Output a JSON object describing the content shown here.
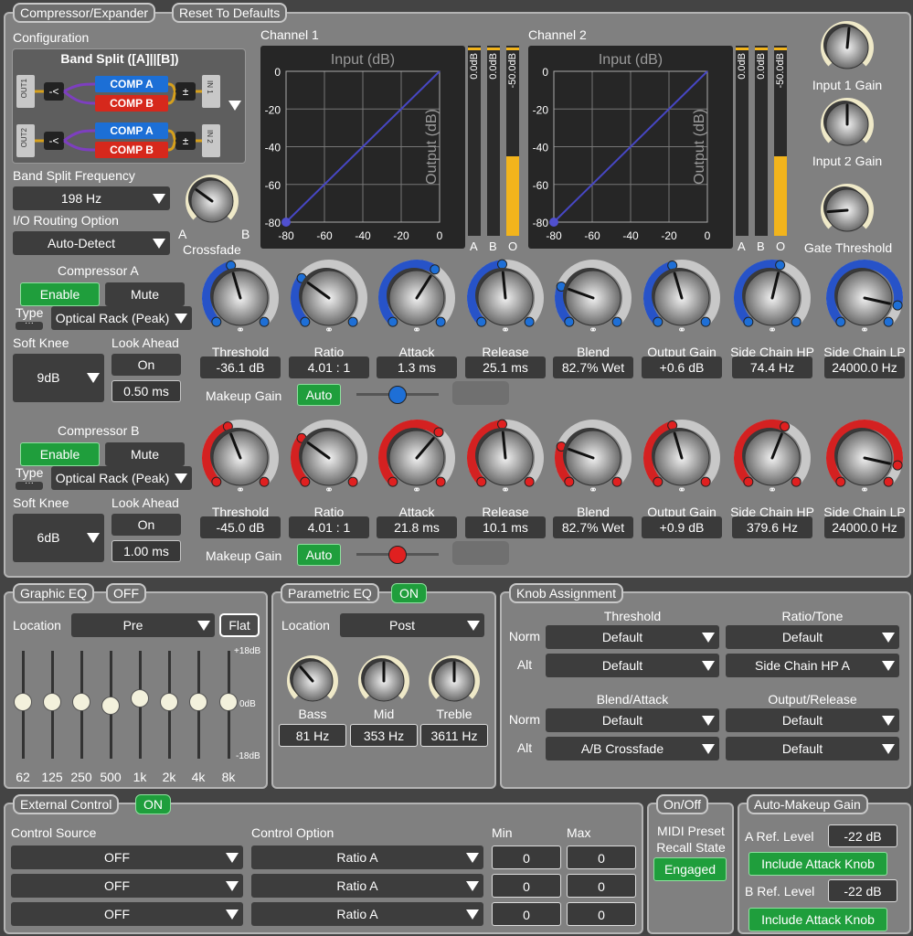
{
  "tabs": {
    "main": "Compressor/Expander",
    "reset": "Reset To Defaults"
  },
  "config": {
    "label": "Configuration",
    "title": "Band Split ([A]||[B])",
    "out1": "OUT1",
    "out2": "OUT2",
    "in1": "IN 1",
    "in2": "IN 2",
    "comp_a": "COMP A",
    "comp_b": "COMP B"
  },
  "bandsplit": {
    "label": "Band Split Frequency",
    "value": "198 Hz"
  },
  "routing": {
    "label": "I/O Routing Option",
    "value": "Auto-Detect"
  },
  "crossfade": {
    "label": "Crossfade",
    "a": "A",
    "b": "B",
    "level": 0.3
  },
  "channels": [
    {
      "label": "Channel 1",
      "graph_title": "Input (dB)",
      "y_axis": "Output (dB)",
      "meter_tops": [
        "0.0dB",
        "0.0dB",
        "-50.0dB"
      ],
      "meter_bottoms": [
        "A",
        "B",
        "O"
      ],
      "meter_level": 0.42
    },
    {
      "label": "Channel 2",
      "graph_title": "Input (dB)",
      "y_axis": "Output (dB)",
      "meter_tops": [
        "0.0dB",
        "0.0dB",
        "-50.0dB"
      ],
      "meter_bottoms": [
        "A",
        "B",
        "O"
      ],
      "meter_level": 0.42
    }
  ],
  "graph_ticks": {
    "y": [
      "0",
      "-20",
      "-40",
      "-60",
      "-80"
    ],
    "x": [
      "-80",
      "-60",
      "-40",
      "-20",
      "0"
    ]
  },
  "right_knobs": [
    {
      "label": "Input 1 Gain",
      "level": 0.52
    },
    {
      "label": "Input 2 Gain",
      "level": 0.5
    },
    {
      "label": "Gate Threshold",
      "level": 0.15
    }
  ],
  "compA": {
    "title": "Compressor A",
    "enable": "Enable",
    "mute": "Mute",
    "type_label": "Type",
    "type_value": "Optical Rack (Peak)",
    "soft_knee_label": "Soft Knee",
    "soft_knee_value": "9dB",
    "look_ahead_label": "Look Ahead",
    "look_ahead_state": "On",
    "look_ahead_value": "0.50 ms",
    "makeup_label": "Makeup Gain",
    "makeup_btn": "Auto",
    "makeup_level": 0.5,
    "knobs": [
      {
        "label": "Threshold",
        "value": "-36.1 dB",
        "level": 0.44
      },
      {
        "label": "Ratio",
        "value": "4.01 : 1",
        "level": 0.3
      },
      {
        "label": "Attack",
        "value": "1.3 ms",
        "level": 0.62
      },
      {
        "label": "Release",
        "value": "25.1 ms",
        "level": 0.48
      },
      {
        "label": "Blend",
        "value": "82.7% Wet",
        "level": 0.24
      },
      {
        "label": "Output Gain",
        "value": "+0.6 dB",
        "level": 0.44
      },
      {
        "label": "Side Chain HP",
        "value": "74.4 Hz",
        "level": 0.55
      },
      {
        "label": "Side Chain LP",
        "value": "24000.0 Hz",
        "level": 0.88
      }
    ]
  },
  "compB": {
    "title": "Compressor B",
    "enable": "Enable",
    "mute": "Mute",
    "type_label": "Type",
    "type_value": "Optical Rack (Peak)",
    "soft_knee_label": "Soft Knee",
    "soft_knee_value": "6dB",
    "look_ahead_label": "Look Ahead",
    "look_ahead_state": "On",
    "look_ahead_value": "1.00 ms",
    "makeup_label": "Makeup Gain",
    "makeup_btn": "Auto",
    "makeup_level": 0.5,
    "knobs": [
      {
        "label": "Threshold",
        "value": "-45.0 dB",
        "level": 0.42
      },
      {
        "label": "Ratio",
        "value": "4.01 : 1",
        "level": 0.3
      },
      {
        "label": "Attack",
        "value": "21.8 ms",
        "level": 0.65
      },
      {
        "label": "Release",
        "value": "10.1 ms",
        "level": 0.48
      },
      {
        "label": "Blend",
        "value": "82.7% Wet",
        "level": 0.24
      },
      {
        "label": "Output Gain",
        "value": "+0.9 dB",
        "level": 0.44
      },
      {
        "label": "Side Chain HP",
        "value": "379.6 Hz",
        "level": 0.58
      },
      {
        "label": "Side Chain LP",
        "value": "24000.0 Hz",
        "level": 0.88
      }
    ]
  },
  "geq": {
    "title": "Graphic EQ",
    "state": "OFF",
    "location_label": "Location",
    "location": "Pre",
    "flat": "Flat",
    "scale": [
      "+18dB",
      "0dB",
      "-18dB"
    ],
    "bands": [
      {
        "f": "62",
        "db": 0
      },
      {
        "f": "125",
        "db": 0
      },
      {
        "f": "250",
        "db": 0
      },
      {
        "f": "500",
        "db": -1
      },
      {
        "f": "1k",
        "db": 1
      },
      {
        "f": "2k",
        "db": 0
      },
      {
        "f": "4k",
        "db": 0
      },
      {
        "f": "8k",
        "db": 0
      }
    ]
  },
  "peq": {
    "title": "Parametric EQ",
    "state": "ON",
    "location_label": "Location",
    "location": "Post",
    "knobs": [
      {
        "label": "Bass",
        "value": "81 Hz",
        "level": 0.35
      },
      {
        "label": "Mid",
        "value": "353 Hz",
        "level": 0.5
      },
      {
        "label": "Treble",
        "value": "3611 Hz",
        "level": 0.5
      }
    ]
  },
  "knob_assign": {
    "title": "Knob Assignment",
    "norm": "Norm",
    "alt": "Alt",
    "groups": [
      {
        "title": "Threshold",
        "norm": "Default",
        "alt": "Default"
      },
      {
        "title": "Ratio/Tone",
        "norm": "Default",
        "alt": "Side Chain HP A"
      },
      {
        "title": "Blend/Attack",
        "norm": "Default",
        "alt": "A/B Crossfade"
      },
      {
        "title": "Output/Release",
        "norm": "Default",
        "alt": "Default"
      }
    ]
  },
  "ext": {
    "title": "External Control",
    "state": "ON",
    "source_label": "Control Source",
    "option_label": "Control Option",
    "min_label": "Min",
    "max_label": "Max",
    "rows": [
      {
        "source": "OFF",
        "option": "Ratio A",
        "min": "0",
        "max": "0"
      },
      {
        "source": "OFF",
        "option": "Ratio A",
        "min": "0",
        "max": "0"
      },
      {
        "source": "OFF",
        "option": "Ratio A",
        "min": "0",
        "max": "0"
      }
    ]
  },
  "onoff": {
    "title": "On/Off",
    "midi": "MIDI Preset Recall State",
    "engaged": "Engaged"
  },
  "amg": {
    "title": "Auto-Makeup Gain",
    "a_label": "A Ref. Level",
    "a_value": "-22 dB",
    "a_btn": "Include Attack Knob",
    "b_label": "B Ref. Level",
    "b_value": "-22 dB",
    "b_btn": "Include Attack Knob"
  },
  "colors": {
    "blue_arc": "#2753c8",
    "blue_dot": "#1e6fd6",
    "red_arc": "#d42121",
    "red_dot": "#e02020",
    "green": "#1f9e3c",
    "meter_yellow": "#f2b41c",
    "curve": "#4747c4"
  }
}
